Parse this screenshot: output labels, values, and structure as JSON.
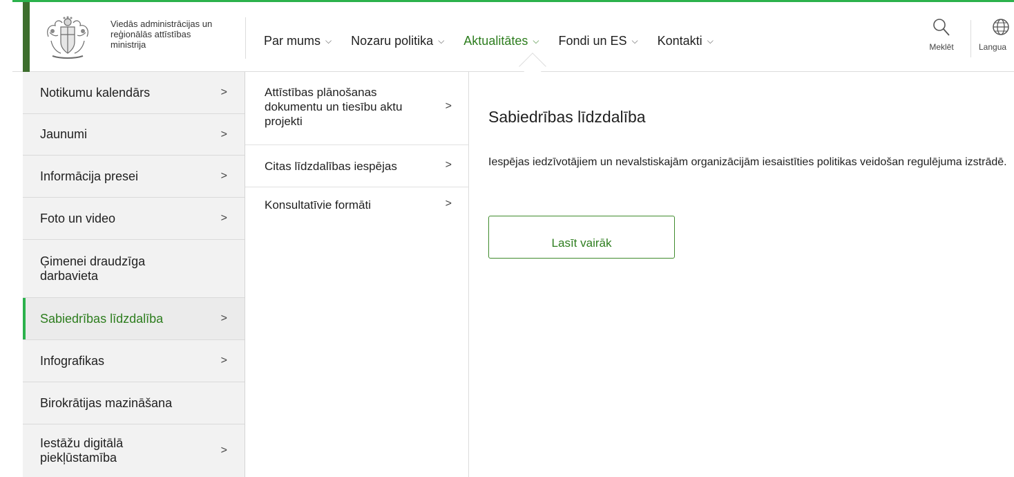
{
  "header": {
    "org_name": [
      "Viedās administrācijas un",
      "reģionālās attīstības",
      "ministrija"
    ],
    "nav": [
      {
        "label": "Par mums",
        "active": false
      },
      {
        "label": "Nozaru politika",
        "active": false
      },
      {
        "label": "Aktualitātes",
        "active": true
      },
      {
        "label": "Fondi un ES",
        "active": false
      },
      {
        "label": "Kontakti",
        "active": false
      }
    ],
    "search_label": "Meklēt",
    "language_label": "Langua",
    "accent_color": "#2d7d1e"
  },
  "left_menu": [
    {
      "label": "Notikumu kalendārs",
      "arrow": ">"
    },
    {
      "label": "Jaunumi",
      "arrow": ">"
    },
    {
      "label": "Informācija presei",
      "arrow": ">"
    },
    {
      "label": "Foto un video",
      "arrow": ">"
    },
    {
      "label": "Ģimenei draudzīga darbavieta",
      "arrow": ""
    },
    {
      "label": "Sabiedrības līdzdalība",
      "arrow": ">",
      "active": true
    },
    {
      "label": "Infografikas",
      "arrow": ">"
    },
    {
      "label": "Birokrātijas mazināšana",
      "arrow": ""
    },
    {
      "label": "Iestāžu digitālā piekļūstamība",
      "arrow": ">"
    }
  ],
  "mid_menu": [
    {
      "label": "Attīstības plānošanas dokumentu un tiesību aktu projekti",
      "arrow": ">"
    },
    {
      "label": "Citas līdzdalības iespējas",
      "arrow": ">"
    },
    {
      "label": "Konsultatīvie formāti",
      "arrow": ">"
    }
  ],
  "content": {
    "title": "Sabiedrības līdzdalība",
    "description": "Iespējas iedzīvotājiem un nevalstiskajām organizācijām iesaistīties politikas veidošan regulējuma izstrādē.",
    "button_label": "Lasīt vairāk"
  }
}
